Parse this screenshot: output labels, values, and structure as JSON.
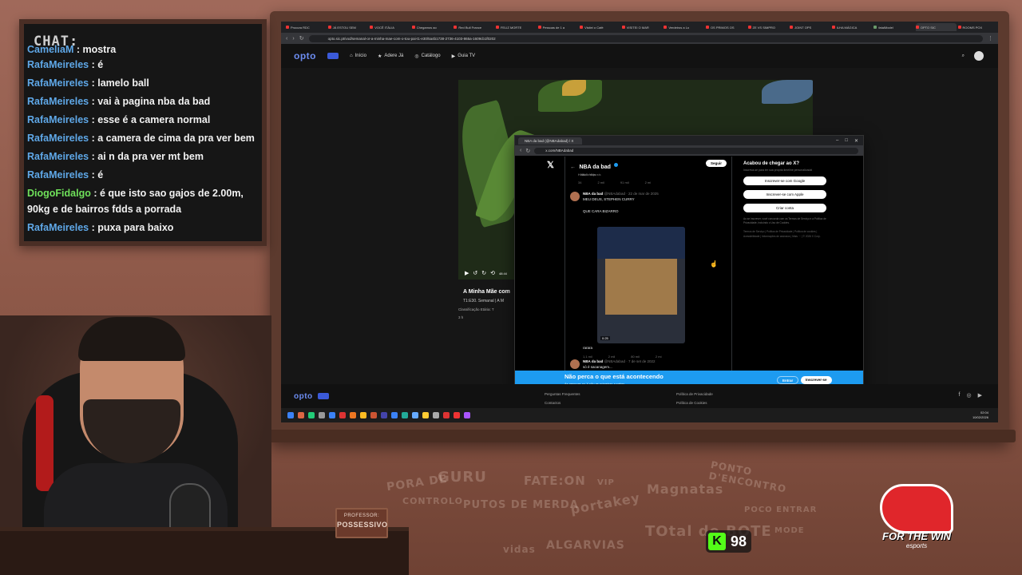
{
  "chat": {
    "title": "CHAT:",
    "messages": [
      {
        "user": "CameliaM",
        "text": ": mostra",
        "green": false,
        "cut": true
      },
      {
        "user": "RafaMeireles",
        "text": ": é",
        "green": false
      },
      {
        "user": "RafaMeireles",
        "text": ": lamelo ball",
        "green": false
      },
      {
        "user": "RafaMeireles",
        "text": ": vai à pagina nba da bad",
        "green": false
      },
      {
        "user": "RafaMeireles",
        "text": ": esse é a camera normal",
        "green": false
      },
      {
        "user": "RafaMeireles",
        "text": ": a camera de cima da pra ver bem",
        "green": false
      },
      {
        "user": "RafaMeireles",
        "text": ": ai n da pra ver mt bem",
        "green": false
      },
      {
        "user": "RafaMeireles",
        "text": ": é",
        "green": false
      },
      {
        "user": "DiogoFidalgo",
        "text": ": é que isto sao gajos de 2.00m, 90kg e de bairros fdds a porrada",
        "green": true
      },
      {
        "user": "RafaMeireles",
        "text": ": puxa para baixo",
        "green": false
      }
    ]
  },
  "browser": {
    "tabs": [
      "Procura RDC",
      "JÁ ESTOU SEM",
      "VOCÊ ITÁLIA",
      "Chegamos ao",
      "Red Bull France",
      "FELIZ MORTE",
      "Pessoas de 1 a",
      "Visitei o Café",
      "VISITEI O MAR",
      "Verdeiros a Lo",
      "OS PRIMOS OS",
      "ZE VS SIMPRO",
      "JOINT OPS",
      "ILHA MÁGICA",
      "fatalModel",
      "OPTO SIC",
      "ROOMS POX"
    ],
    "active_tab": "OPTO SIC",
    "url": "opto.sic.pt/vod/semanal-or-a-minha-mae-com-o-tou-pai-t1-e30/5a4b1738-2736-4103-865a-1609cb1f0202"
  },
  "opto": {
    "logo": "opto",
    "nav": [
      {
        "icon": "home-icon",
        "label": "Início"
      },
      {
        "icon": "star-icon",
        "label": "Adere Já"
      },
      {
        "icon": "broadcast-icon",
        "label": "Catálogo"
      },
      {
        "icon": "play-icon",
        "label": "Guia TV"
      }
    ],
    "video_title": "A Minha Mãe com",
    "video_sub": "T1:E30. Semanal | A M",
    "classification": "Classificação Etária: T",
    "year": "3 h",
    "time_display": "48:44",
    "footer_links_1": [
      "Perguntas Frequentes",
      "Contactos"
    ],
    "footer_links_2": [
      "Política de Privacidade",
      "Política de Cookies"
    ],
    "social": [
      "facebook-icon",
      "instagram-icon",
      "youtube-icon"
    ],
    "clock_time": "02:04",
    "clock_date": "10/02/2026"
  },
  "popup": {
    "tab_title": "NBA da bad (@NBAdabad) / X",
    "url": "x.com/NBAdabad",
    "profile_name": "NBA da bad",
    "profile_posts": "36,7 mil posts",
    "follow_label": "Seguir",
    "pinned_label": "Historic Vids",
    "tweet1": {
      "author": "NBA da bad",
      "handle": "@NBAdabad · 22 de mar de 2025",
      "line1": "MEU DEUS, STEPHEN CURRY",
      "line2": "QUE CARA BIZARRO",
      "media_time": "0:25",
      "caption": "rarara",
      "stats": [
        "1,1 mil",
        "2 mil",
        "80 mil",
        "2 mi"
      ]
    },
    "tweet0_stats": [
      "34",
      "2 mil",
      "91 mil",
      "2 mi"
    ],
    "tweet2": {
      "author": "NBA da bad",
      "handle": "@NBAdabad · 7 de set de 2022",
      "line1": "só é sacanagem..."
    },
    "signup": {
      "title": "Acabou de chegar ao X?",
      "subtitle": "Inscreva-se para ter sua própria timeline personalizada!",
      "google": "Inscrever-se com Google",
      "apple": "Inscrever-se com Apple",
      "create": "Criar conta",
      "legal": "Ao se inscrever, você concorda com os Termos de Serviço e a Política de Privacidade, incluindo o Uso de Cookies.",
      "footer": "Termos de Serviço | Política de Privacidade | Política de cookies | Acessibilidade | Informações de anúncios | Mais ··· | © 2026 X Corp."
    },
    "banner": {
      "title": "Não perca o que está acontecendo",
      "subtitle": "As pessoas no X são as primeiras a saber.",
      "login": "Entrar",
      "signup": "Inscrever-se"
    }
  },
  "overlay": {
    "plate_line1": "PROFESSOR:",
    "plate_line2": "POSSESSIVO",
    "kick_count": "98",
    "kick_letter": "K",
    "logo_text": "FOR THE WIN",
    "logo_sub": "esports",
    "doodles": [
      "PORA DE",
      "GURU",
      "FATE:ON",
      "VIP",
      "Magnatas",
      "PONTO D'ENCONTRO",
      "CONTROLO",
      "PUTOS DE MERDA",
      "portakey",
      "POCO ENTRAR",
      "TOtal de BOTE",
      "ALGARVIAS",
      "vidas",
      "MODE"
    ]
  },
  "colors": {
    "chat_user": "#5fa8e8",
    "chat_user_green": "#6fe05a",
    "x_blue": "#1d9bf0",
    "opto_blue": "#6c8cf0",
    "kick_green": "#53fc18"
  }
}
